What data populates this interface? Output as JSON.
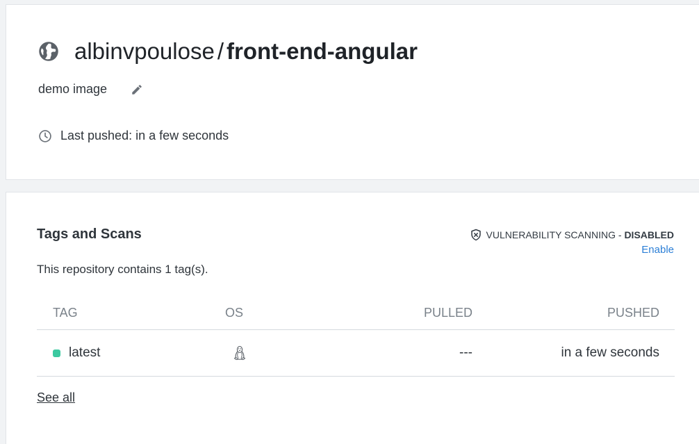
{
  "repo": {
    "owner": "albinvpoulose",
    "separator": "/",
    "name": "front-end-angular",
    "description": "demo image",
    "last_pushed": "Last pushed: in a few seconds",
    "icon": "globe-icon"
  },
  "tags_section": {
    "title": "Tags and Scans",
    "subtitle": "This repository contains 1 tag(s).",
    "vuln_label": "VULNERABILITY SCANNING - ",
    "vuln_status": "DISABLED",
    "enable_label": "Enable",
    "columns": [
      "TAG",
      "OS",
      "PULLED",
      "PUSHED"
    ],
    "rows": [
      {
        "tag": "latest",
        "os": "linux-icon",
        "pulled": "---",
        "pushed": "in a few seconds"
      }
    ],
    "see_all_label": "See all"
  },
  "colors": {
    "tag_dot": "#3cc9a0",
    "link": "#2c7fd6"
  }
}
